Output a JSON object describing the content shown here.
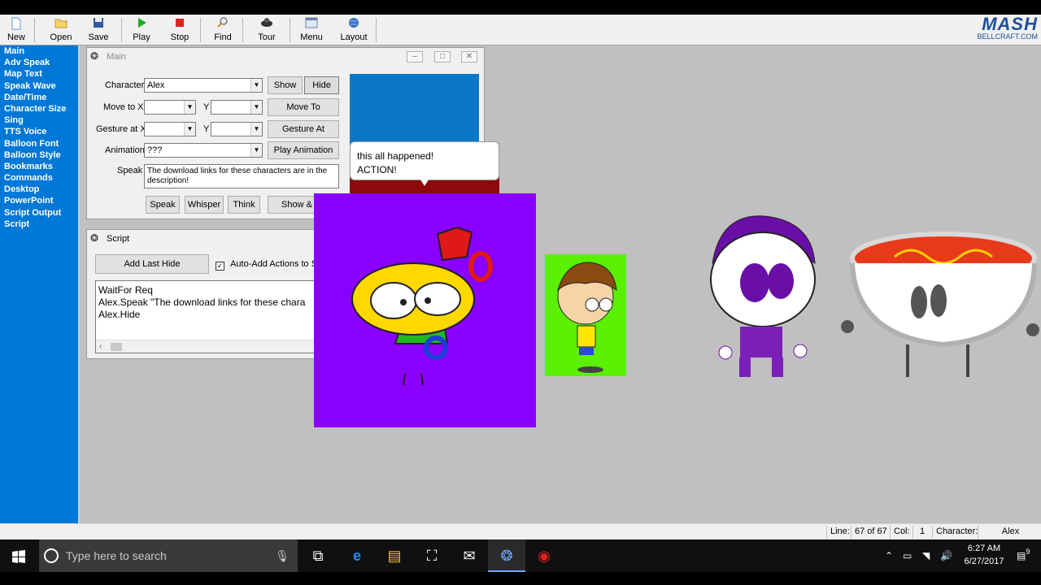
{
  "toolbar": {
    "buttons": [
      {
        "label": "New",
        "icon": "new-file-icon"
      },
      {
        "label": "Open",
        "icon": "open-folder-icon"
      },
      {
        "label": "Save",
        "icon": "save-disk-icon"
      },
      {
        "label": "Play",
        "icon": "play-icon"
      },
      {
        "label": "Stop",
        "icon": "stop-icon"
      },
      {
        "label": "Find",
        "icon": "find-magnifier-icon"
      },
      {
        "label": "Tour",
        "icon": "tour-genie-icon"
      },
      {
        "label": "Menu",
        "icon": "menu-window-icon"
      },
      {
        "label": "Layout",
        "icon": "layout-globe-icon"
      }
    ],
    "logo_text": "MASH",
    "logo_sub": "BELLCRAFT.COM"
  },
  "sidebar": {
    "items": [
      "Main",
      "Adv Speak",
      "Map Text",
      "Speak Wave",
      "Date/Time",
      "Character Size",
      "Sing",
      "TTS Voice",
      "Balloon Font",
      "Balloon Style",
      "Bookmarks",
      "Commands",
      "Desktop",
      "PowerPoint",
      "Script Output",
      "Script"
    ]
  },
  "main_window": {
    "title": "Main",
    "character_label": "Character",
    "character_value": "Alex",
    "show_label": "Show",
    "hide_label": "Hide",
    "move_to_x_label": "Move to X",
    "y_label": "Y",
    "move_to_label": "Move To",
    "gesture_at_x_label": "Gesture at X",
    "gesture_at_label": "Gesture At",
    "animation_label": "Animation",
    "animation_value": "???",
    "play_animation_label": "Play Animation",
    "speak_label": "Speak",
    "speak_text": "The download links for these characters are in the description!",
    "speak_button": "Speak",
    "whisper_button": "Whisper",
    "think_button": "Think",
    "show_and_button": "Show & T"
  },
  "script_window": {
    "title": "Script",
    "add_last_hide": "Add Last Hide",
    "auto_add_label": "Auto-Add Actions to Sc",
    "auto_add_checked": true,
    "lines": [
      "WaitFor Req",
      "Alex.Speak \"The download links for these chara",
      "Alex.Hide"
    ]
  },
  "balloon": {
    "line1": "this all happened!",
    "line2": "ACTION!"
  },
  "statusbar": {
    "line_label": "Line:",
    "line_value": "67 of 67",
    "col_label": "Col:",
    "col_value": "1",
    "character_label": "Character:",
    "character_value": "Alex"
  },
  "taskbar": {
    "search_placeholder": "Type here to search",
    "time": "6:27 AM",
    "date": "6/27/2017",
    "notification_count": "9"
  },
  "colors": {
    "sidebar_bg": "#0078d7",
    "purple_char_bg": "#8a00ff",
    "green_char_bg": "#5af000",
    "taskbar_bg": "#101010"
  }
}
